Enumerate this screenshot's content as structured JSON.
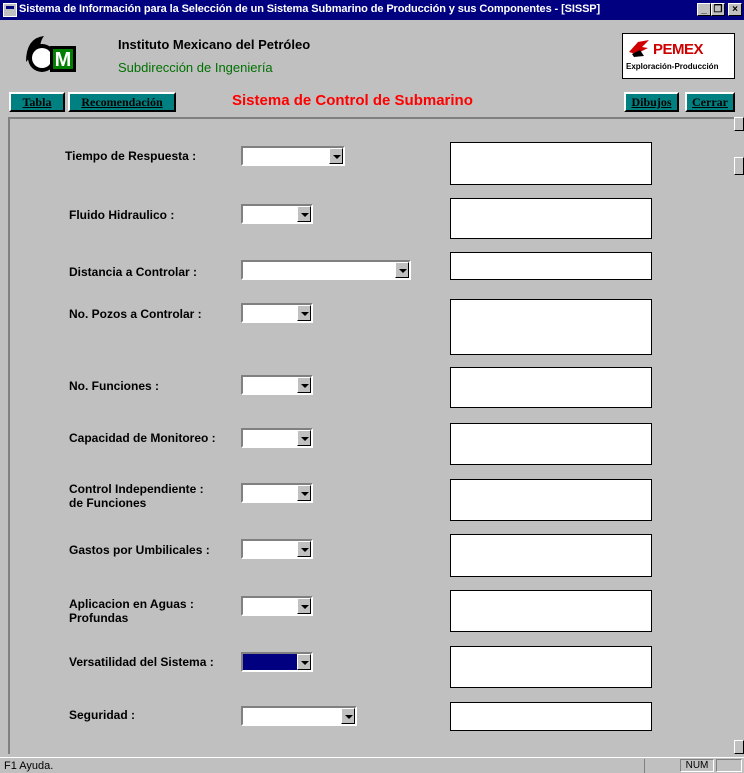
{
  "window": {
    "title": "Sistema de Información para la Selección de un Sistema Submarino de Producción y sus Componentes - [SISSP]",
    "minimize_glyph": "_",
    "restore_glyph": "❐",
    "close_glyph": "×"
  },
  "header": {
    "institution": "Instituto Mexicano del Petróleo",
    "department": "Subdirección de Ingeniería",
    "imp_logo_letter": "M",
    "pemex_word": "PEMEX",
    "pemex_tagline": "Exploración-Producción"
  },
  "toolbar": {
    "tabla_label": "Tabla",
    "recomendacion_label": "Recomendación",
    "form_title": "Sistema de Control de Submarino",
    "dibujos_label": "Dibujos",
    "cerrar_label": "Cerrar"
  },
  "form": {
    "fields": [
      {
        "label": "Tiempo de Respuesta :",
        "value": ""
      },
      {
        "label": "Fluido Hidraulico :",
        "value": ""
      },
      {
        "label": "Distancia a Controlar :",
        "value": ""
      },
      {
        "label": "No. Pozos a Controlar :",
        "value": ""
      },
      {
        "label": "No. Funciones :",
        "value": ""
      },
      {
        "label": "Capacidad de Monitoreo :",
        "value": ""
      },
      {
        "label": "Control Independiente : de Funciones",
        "line1": "Control Independiente :",
        "line2": "de Funciones",
        "value": ""
      },
      {
        "label": "Gastos por Umbilicales :",
        "value": ""
      },
      {
        "label": "Aplicacion en Aguas : Profundas",
        "line1": "Aplicacion en Aguas :",
        "line2": "Profundas",
        "value": ""
      },
      {
        "label": "Versatilidad del Sistema :",
        "value": "",
        "selected": true
      },
      {
        "label": "Seguridad :",
        "value": ""
      }
    ]
  },
  "statusbar": {
    "help_text": "F1 Ayuda.",
    "num_indicator": "NUM"
  },
  "colors": {
    "title_bar": "#000080",
    "button_teal": "#008080",
    "form_title_red": "#ff0000",
    "department_green": "#007000",
    "selection": "#000080"
  }
}
